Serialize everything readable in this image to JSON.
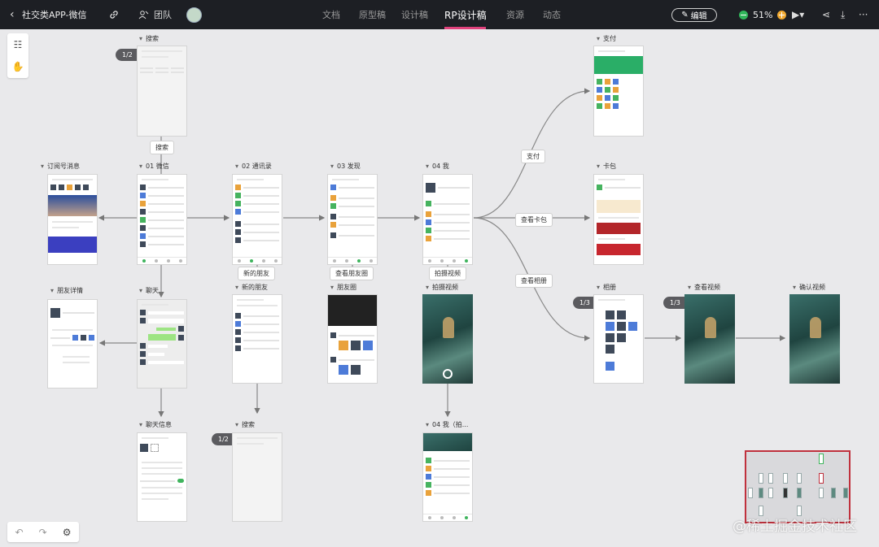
{
  "header": {
    "back_icon": "chevron-left-icon",
    "project_name": "社交类APP-微信",
    "team_label": "团队",
    "tabs": [
      {
        "label": "文档",
        "active": false
      },
      {
        "label": "原型稿",
        "active": false
      },
      {
        "label": "设计稿",
        "active": false
      },
      {
        "label": "RP设计稿",
        "active": true
      },
      {
        "label": "资源",
        "active": false
      },
      {
        "label": "动态",
        "active": false
      }
    ],
    "edit_label": "编辑",
    "zoom": "51%",
    "accent_color": "#e0427c"
  },
  "canvas": {
    "screens": {
      "search_top": "搜索",
      "subscribe": "订阅号消息",
      "wechat": "01 微信",
      "contacts": "02 通讯录",
      "discover": "03 发现",
      "me": "04 我",
      "pay": "支付",
      "cardpack": "卡包",
      "friend_detail": "朋友详情",
      "chat": "聊天",
      "new_friend": "新的朋友",
      "moments": "朋友圈",
      "shoot_video": "拍摄视频",
      "album": "相册",
      "view_video": "查看视频",
      "confirm_video": "确认视频",
      "chat_info": "聊天信息",
      "search_bottom": "搜索",
      "me_shoot": "04 我（拍..."
    },
    "actions": {
      "search": "搜索",
      "new_friend": "新的朋友",
      "view_moments": "查看朋友圈",
      "shoot_video": "拍摄视频",
      "pay": "支付",
      "view_cardpack": "查看卡包",
      "view_album": "查看相册"
    },
    "pagers": {
      "search_top": "1/2",
      "search_bottom": "1/2",
      "album": "1/3",
      "view_video": "1/3"
    }
  },
  "toolbar_icons": [
    "flow-icon",
    "hand-icon"
  ],
  "bottom_icons": [
    "undo-icon",
    "redo-icon",
    "gear-icon"
  ],
  "watermark": "@稀土掘金技术社区"
}
